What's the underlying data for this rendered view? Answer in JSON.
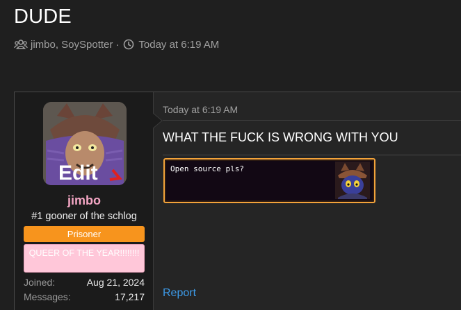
{
  "thread": {
    "title": "DUDE",
    "participants": "jimbo, SoySpotter",
    "separator": "·",
    "time": "Today at 6:19 AM",
    "icons": [
      "users-icon",
      "clock-icon"
    ]
  },
  "post": {
    "author": {
      "username": "jimbo",
      "user_title": "#1 gooner of the schlog",
      "avatar_overlay_text": "Edit",
      "banners": [
        {
          "label": "Prisoner",
          "color": "#f7941d"
        },
        {
          "label": "QUEER OF THE YEAR!!!!!!!!",
          "color": "#ffc7d9"
        }
      ],
      "stats": {
        "joined_label": "Joined:",
        "joined_value": "Aug 21, 2024",
        "messages_label": "Messages:",
        "messages_value": "17,217"
      }
    },
    "date": "Today at 6:19 AM",
    "body": "WHAT THE FUCK IS WRONG WITH YOU",
    "embedded_dialog": {
      "text": "Open source pls?"
    },
    "actions": {
      "report": "Report"
    }
  },
  "colors": {
    "background": "#1f1f1f",
    "username": "#f4a6c4",
    "link": "#3d9be9",
    "dialog_border": "#f3a33a"
  }
}
